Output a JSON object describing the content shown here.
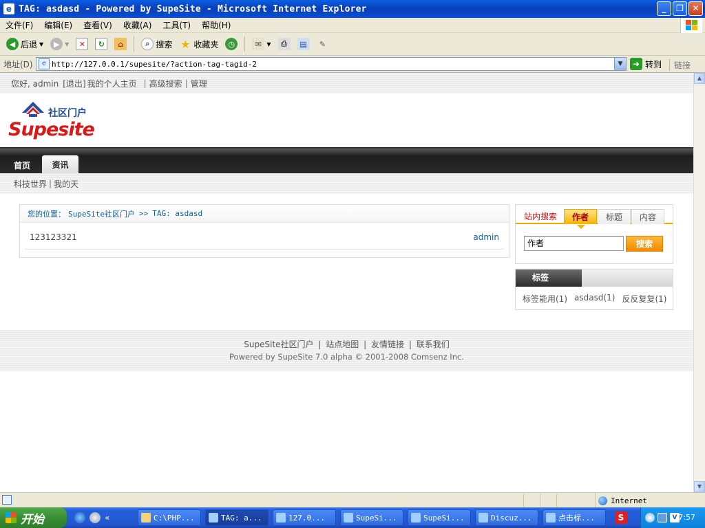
{
  "window": {
    "title": "TAG: asdasd - Powered by SupeSite - Microsoft Internet Explorer",
    "controls": [
      "_",
      "❐",
      "✕"
    ]
  },
  "menubar": [
    "文件(F)",
    "编辑(E)",
    "查看(V)",
    "收藏(A)",
    "工具(T)",
    "帮助(H)"
  ],
  "toolbar": {
    "back": "后退",
    "search": "搜索",
    "favorites": "收藏夹"
  },
  "address": {
    "label": "地址(D)",
    "url": "http://127.0.0.1/supesite/?action-tag-tagid-2",
    "go": "转到",
    "links": "链接"
  },
  "page": {
    "topnav": {
      "greeting": "您好, admin",
      "logout": "[退出]",
      "homepage": "我的个人主页",
      "advanced_search": "高级搜索",
      "admin": "管理"
    },
    "logo": {
      "brand": "Supesite",
      "tagline": "社区门户"
    },
    "mainnav": {
      "home": "首页",
      "news": "资讯"
    },
    "subnav": [
      "科技世界",
      "我的天"
    ],
    "breadcrumb": {
      "label": "您的位置：",
      "site": "SupeSite社区门户",
      "sep": ">>",
      "current": "TAG: asdasd"
    },
    "items": [
      {
        "title": "123123321",
        "author": "admin"
      }
    ],
    "search": {
      "label": "站内搜索",
      "tabs": [
        "作者",
        "标题",
        "内容"
      ],
      "input_value": "作者",
      "button": "搜索"
    },
    "tags": {
      "heading": "标签",
      "list": [
        "标签能用(1)",
        "asdasd(1)",
        "反反复复(1)"
      ]
    },
    "footer": {
      "links": [
        "SupeSite社区门户",
        "站点地图",
        "友情链接",
        "联系我们"
      ],
      "powered": "Powered by SupeSite 7.0 alpha © 2001-2008 Comsenz Inc."
    }
  },
  "statusbar": {
    "zone": "Internet"
  },
  "taskbar": {
    "start": "开始",
    "tasks": [
      "C:\\PHP...",
      "TAG: a...",
      "127.0...",
      "SupeSi...",
      "SupeSi...",
      "Discuz...",
      "点击标..."
    ],
    "clock": "7:57"
  },
  "colors": {
    "link_blue": "#0f5ea0",
    "accent_orange": "#f5a500",
    "search_label_red": "#d01010",
    "xp_titlebar": "#0a47c8"
  }
}
